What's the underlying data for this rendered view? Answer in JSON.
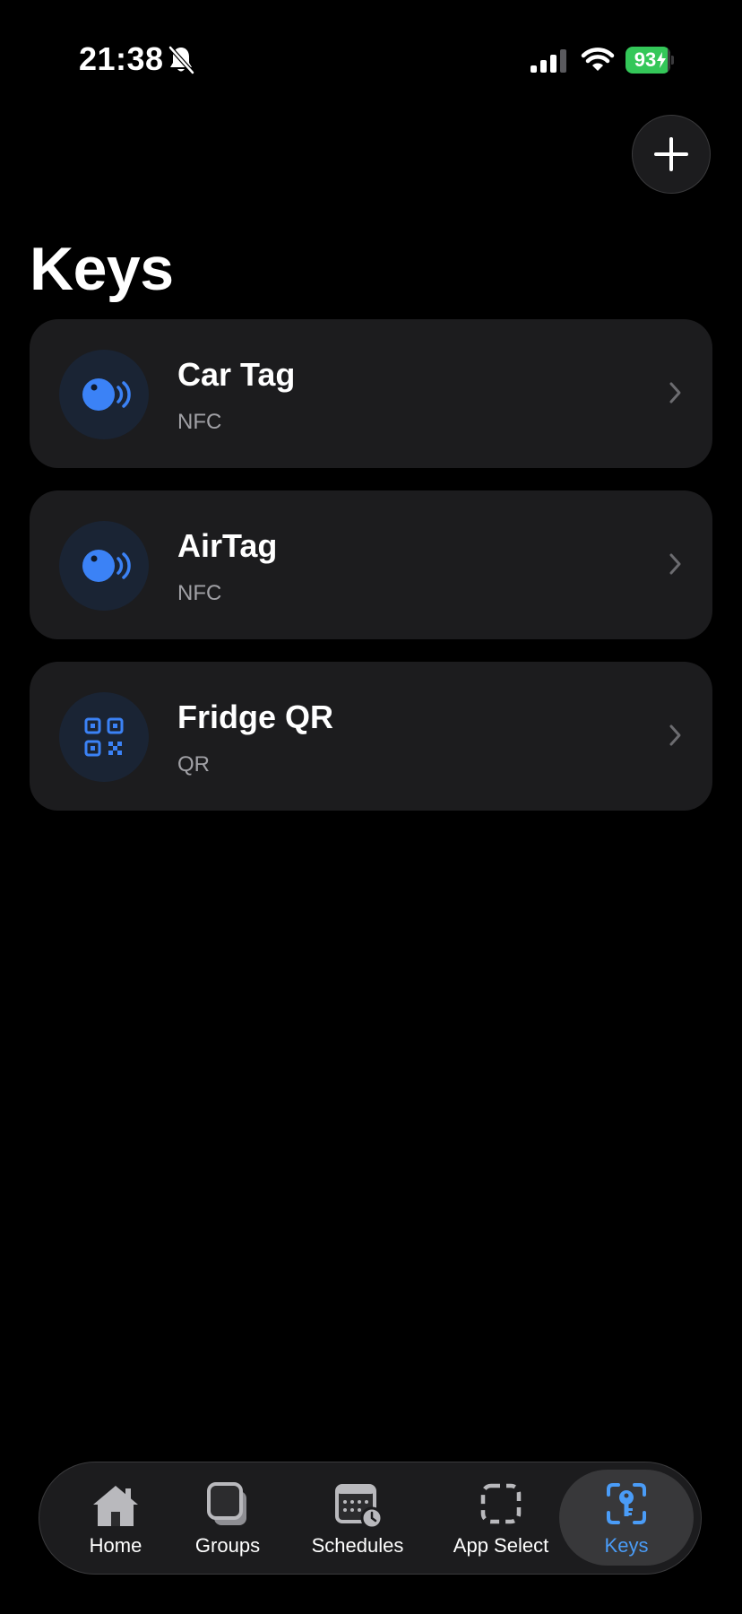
{
  "status_bar": {
    "time": "21:38",
    "battery_percent": "93",
    "battery_level": 0.93,
    "icons": [
      "bell-slash-icon",
      "cellular-signal-icon",
      "wifi-icon",
      "battery-charging-icon"
    ]
  },
  "header": {
    "add_icon": "plus-icon",
    "title": "Keys"
  },
  "keys": [
    {
      "name": "Car Tag",
      "type": "NFC",
      "icon": "nfc-tag-icon"
    },
    {
      "name": "AirTag",
      "type": "NFC",
      "icon": "nfc-tag-icon"
    },
    {
      "name": "Fridge QR",
      "type": "QR",
      "icon": "qr-code-icon"
    }
  ],
  "tab_bar": {
    "tabs": [
      {
        "label": "Home",
        "icon": "house-icon"
      },
      {
        "label": "Groups",
        "icon": "stacked-squares-icon"
      },
      {
        "label": "Schedules",
        "icon": "calendar-clock-icon"
      },
      {
        "label": "App Select",
        "icon": "dashed-square-icon"
      },
      {
        "label": "Keys",
        "icon": "key-viewfinder-icon",
        "active": true
      }
    ]
  },
  "colors": {
    "background": "#000000",
    "card": "#1c1c1e",
    "accent": "#4a9cf7",
    "icon_blue": "#3b82f6",
    "secondary_text": "#a1a1a6",
    "battery_green": "#34c759"
  }
}
